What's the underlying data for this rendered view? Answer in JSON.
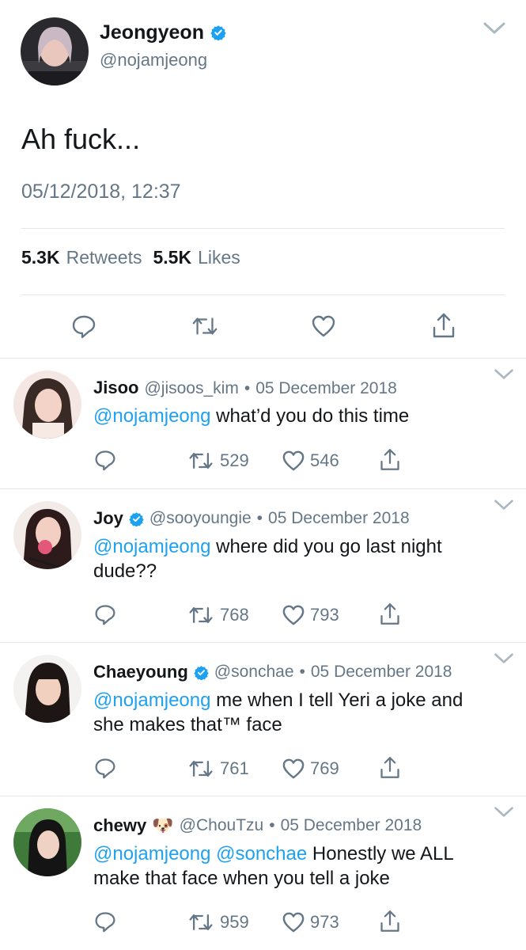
{
  "main_tweet": {
    "name": "Jeongyeon",
    "handle": "@nojamjeong",
    "text": "Ah fuck...",
    "timestamp": "05/12/2018, 12:37",
    "retweets_count": "5.3K",
    "retweets_label": "Retweets",
    "likes_count": "5.5K",
    "likes_label": "Likes"
  },
  "replies": [
    {
      "name": "Jisoo",
      "verified": false,
      "handle": "@jisoos_kim",
      "date": "05 December 2018",
      "mentions": "@nojamjeong",
      "text_line1": "what’d you do this time",
      "text_line2": "",
      "retweets": "529",
      "likes": "546"
    },
    {
      "name": "Joy",
      "verified": true,
      "handle": "@sooyoungie",
      "date": "05 December 2018",
      "mentions": "@nojamjeong",
      "text_line1": "where did you go last night",
      "text_line2": "dude??",
      "retweets": "768",
      "likes": "793"
    },
    {
      "name": "Chaeyoung",
      "verified": true,
      "handle": "@sonchae",
      "date": "05 December 2018",
      "mentions": "@nojamjeong",
      "text_line1": "me when I tell Yeri a joke and",
      "text_line2": "she makes that™ face",
      "retweets": "761",
      "likes": "769"
    },
    {
      "name": "chewy",
      "emoji": "🐶",
      "verified": false,
      "handle": "@ChouTzu",
      "date": "05 December 2018",
      "mentions": "@nojamjeong @sonchae",
      "text_line1": "Honestly we ALL",
      "text_line2": "make that face when you tell a joke",
      "retweets": "959",
      "likes": "973"
    }
  ],
  "colors": {
    "link": "#1da1f2",
    "muted": "#657786",
    "divider": "#e1e8ed",
    "text": "#14171a"
  },
  "icons": [
    "chevron-down-icon",
    "verified-badge-icon",
    "reply-icon",
    "retweet-icon",
    "like-icon",
    "share-icon"
  ]
}
